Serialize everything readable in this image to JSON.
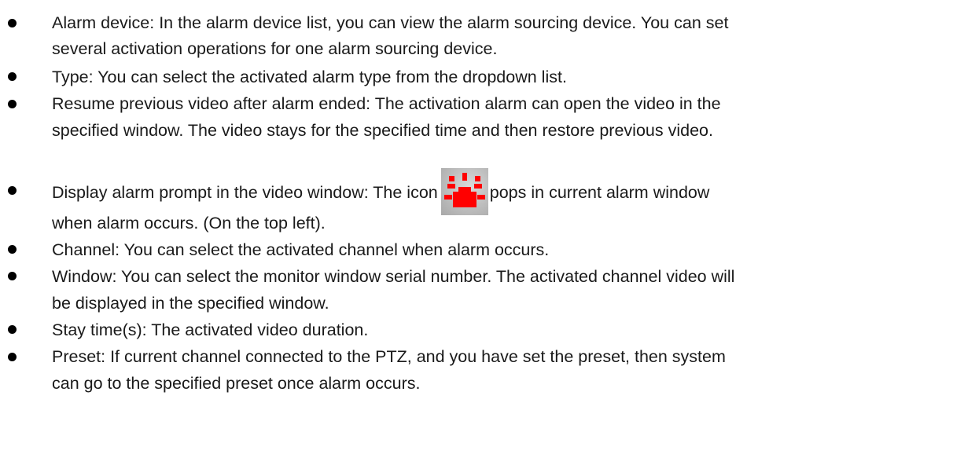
{
  "items": [
    {
      "lines": [
        "Alarm device: In the alarm device list, you can view the alarm sourcing device. You can set",
        "several activation operations for one alarm sourcing device."
      ]
    },
    {
      "lines": [
        "Type: You can select the activated alarm type from the dropdown list."
      ]
    },
    {
      "lines": [
        "Resume previous video after alarm ended: The activation alarm can open the video in the",
        "specified window. The video stays for the specified time and then restore previous video."
      ]
    },
    {
      "line1_before_icon": "Display alarm prompt in the video window: The icon",
      "line1_after_icon": "pops in current alarm window",
      "line2": "when alarm occurs. (On the top left).",
      "icon": "alarm-light-icon"
    },
    {
      "lines": [
        "Channel: You can select the activated channel when alarm occurs."
      ]
    },
    {
      "lines": [
        "Window: You can select the monitor window serial number. The activated channel video will",
        "be displayed in the specified window."
      ]
    },
    {
      "lines": [
        "Stay time(s): The activated video duration."
      ]
    },
    {
      "lines": [
        "Preset: If current channel connected to the PTZ, and you have set the preset, then system",
        "can go to the specified preset once alarm occurs."
      ]
    }
  ],
  "colors": {
    "text": "#1a1a1a",
    "alarm_red": "#ff0000"
  }
}
